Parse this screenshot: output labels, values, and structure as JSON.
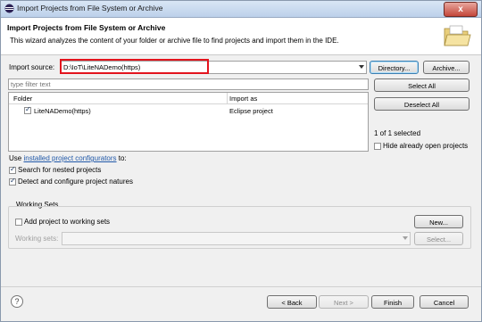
{
  "window": {
    "title": "Import Projects from File System or Archive",
    "close_glyph": "x"
  },
  "banner": {
    "title": "Import Projects from File System or Archive",
    "description": "This wizard analyzes the content of your folder or archive file to find projects and import them in the IDE.",
    "icon": "folder-icon"
  },
  "import_source": {
    "label": "Import source:",
    "value": "D:\\IoT\\LiteNADemo(https)",
    "directory_button": "Directory...",
    "archive_button": "Archive..."
  },
  "filter": {
    "placeholder": "type filter text"
  },
  "table": {
    "columns": [
      "Folder",
      "Import as"
    ],
    "rows": [
      {
        "folder": "LiteNADemo(https)",
        "import_as": "Eclipse project",
        "checked": true
      }
    ]
  },
  "side_buttons": {
    "select_all": "Select All",
    "deselect_all": "Deselect All"
  },
  "selection": {
    "count_text": "1 of 1 selected",
    "hide_open_label": "Hide already open projects"
  },
  "options": {
    "use_prefix": "Use",
    "configurators_link": "installed project configurators",
    "use_suffix": "to:",
    "search_nested": "Search for nested projects",
    "detect_natures": "Detect and configure project natures"
  },
  "working_sets": {
    "title": "Working Sets",
    "add_label": "Add project to working sets",
    "new_button": "New...",
    "sets_label": "Working sets:",
    "select_button": "Select..."
  },
  "footer": {
    "help": "?",
    "back": "< Back",
    "next": "Next >",
    "finish": "Finish",
    "cancel": "Cancel"
  },
  "colors": {
    "highlight_box": "#e3141e",
    "link": "#2058a8",
    "titlebar": "#bcd0ea"
  }
}
